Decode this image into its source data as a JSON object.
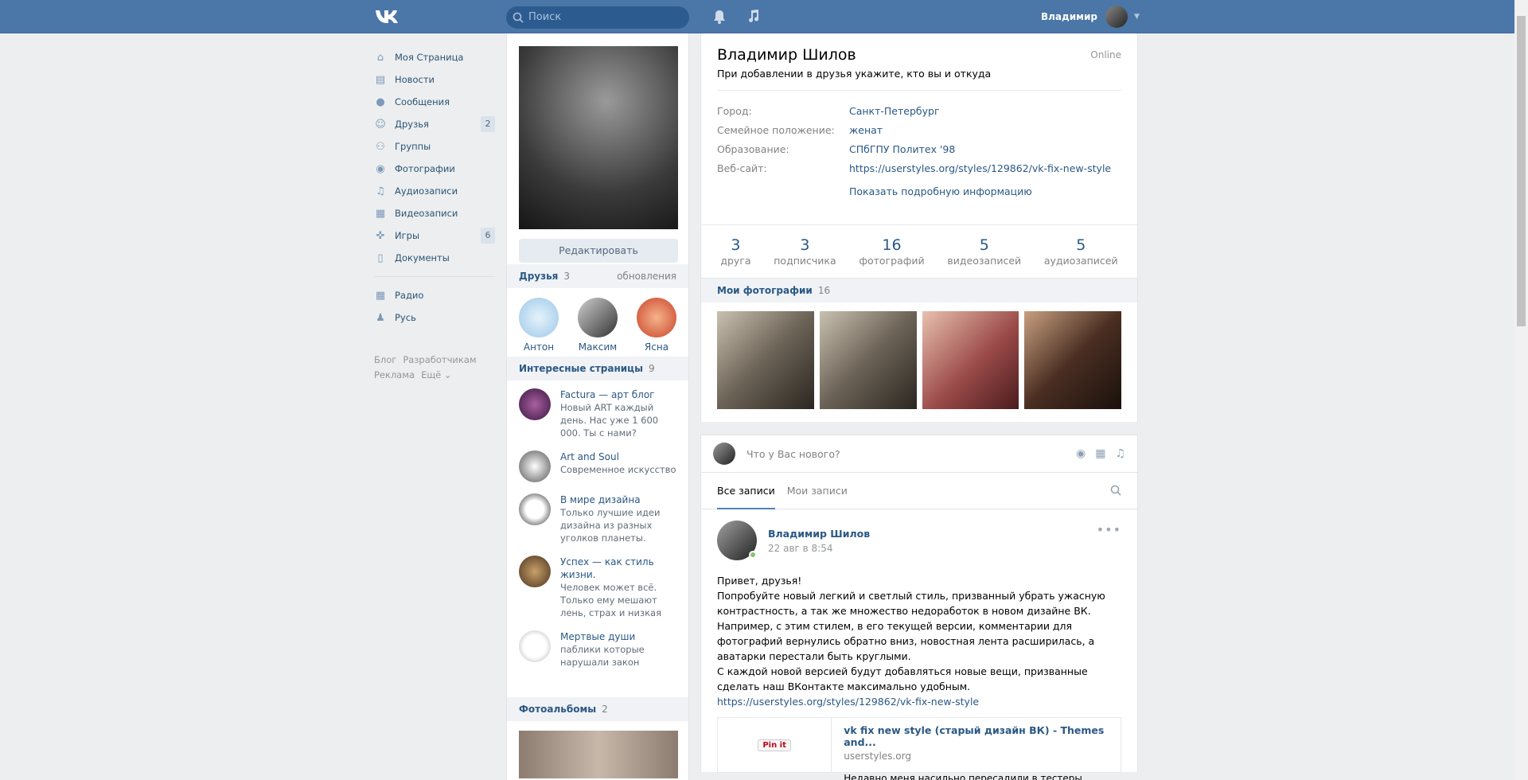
{
  "header": {
    "search_placeholder": "Поиск",
    "user_name": "Владимир"
  },
  "nav": {
    "items": [
      {
        "label": "Моя Страница",
        "icon": "home-icon"
      },
      {
        "label": "Новости",
        "icon": "news-icon"
      },
      {
        "label": "Сообщения",
        "icon": "messages-icon"
      },
      {
        "label": "Друзья",
        "icon": "friends-icon",
        "count": "2"
      },
      {
        "label": "Группы",
        "icon": "groups-icon"
      },
      {
        "label": "Фотографии",
        "icon": "camera-icon"
      },
      {
        "label": "Аудиозаписи",
        "icon": "music-icon"
      },
      {
        "label": "Видеозаписи",
        "icon": "video-icon"
      },
      {
        "label": "Игры",
        "icon": "gamepad-icon",
        "count": "6"
      },
      {
        "label": "Документы",
        "icon": "document-icon"
      }
    ],
    "apps": [
      {
        "label": "Радио",
        "icon": "apps-icon"
      },
      {
        "label": "Русь",
        "icon": "app-person-icon"
      }
    ],
    "footer": {
      "blog": "Блог",
      "dev": "Разработчикам",
      "ads": "Реклама",
      "more": "Ещё ⌄"
    }
  },
  "mid": {
    "edit_label": "Редактировать",
    "friends_title": "Друзья",
    "friends_count": "3",
    "friends_updates": "обновления",
    "friends": [
      "Антон",
      "Максим",
      "Ясна"
    ],
    "pages_title": "Интересные страницы",
    "pages_count": "9",
    "pages": [
      {
        "name": "Factura — арт блог",
        "desc": "Новый ART каждый день. Нас уже 1 600 000. Ты с нами?"
      },
      {
        "name": "Art and Soul",
        "desc": "Современное искусство"
      },
      {
        "name": "В мире дизайна",
        "desc": "Только лучшие идеи дизайна из разных уголков планеты."
      },
      {
        "name": "Успех — как стиль жизни.",
        "desc": "Человек может всё. Только ему мешают лень, страх и низкая"
      },
      {
        "name": "Мертвые души",
        "desc": "паблики которые нарушали закон"
      }
    ],
    "albums_title": "Фотоальбомы",
    "albums_count": "2"
  },
  "profile": {
    "name": "Владимир Шилов",
    "online": "Online",
    "status": "При добавлении в друзья укажите, кто вы и откуда",
    "info": [
      {
        "k": "Город:",
        "v": "Санкт-Петербург"
      },
      {
        "k": "Семейное положение:",
        "v": "женат"
      },
      {
        "k": "Образование:",
        "v": "СПбГПУ Политех '98"
      },
      {
        "k": "Веб-сайт:",
        "v": "https://userstyles.org/styles/129862/vk-fix-new-style"
      }
    ],
    "more_info": "Показать подробную информацию",
    "counters": [
      {
        "num": "3",
        "lbl": "друга"
      },
      {
        "num": "3",
        "lbl": "подписчика"
      },
      {
        "num": "16",
        "lbl": "фотографий"
      },
      {
        "num": "5",
        "lbl": "видеозаписей"
      },
      {
        "num": "5",
        "lbl": "аудиозаписей"
      }
    ],
    "photos_title": "Мои фотографии",
    "photos_count": "16"
  },
  "wall": {
    "composer_placeholder": "Что у Вас нового?",
    "tab_all": "Все записи",
    "tab_mine": "Мои записи",
    "post": {
      "author": "Владимир Шилов",
      "date": "22 авг в 8:54",
      "line1": "Привет, друзья!",
      "line2": "Попробуйте новый легкий и светлый стиль, призванный убрать ужасную контрастность, а так же множество недоработок в новом дизайне ВК. Например, с этим стилем, в его текущей версии, комментарии для фотографий вернулись обратно вниз, новостная лента расширилась, а аватарки перестали быть круглыми.",
      "line3": "С каждой новой версией будут добавляться новые вещи, призванные сделать наш ВКонтакте максимально удобным.",
      "link": "https://userstyles.org/styles/129862/vk-fix-new-style",
      "snippet_title": "vk fix new style (старый дизайн ВК) - Themes and...",
      "snippet_domain": "userstyles.org",
      "snippet_desc": "Недавно меня насильно пересадили в тестеры",
      "pin_label": "Pin it"
    }
  }
}
